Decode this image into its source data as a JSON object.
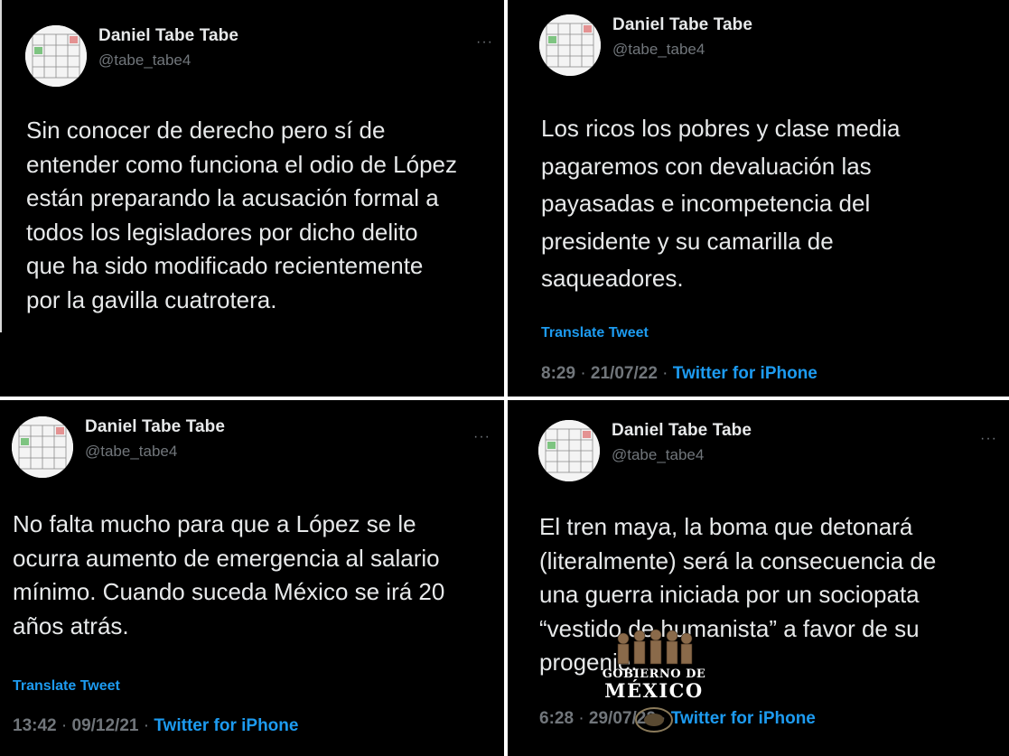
{
  "tweets": [
    {
      "author": {
        "name": "Daniel Tabe Tabe",
        "handle": "@tabe_tabe4",
        "avatar": "avatar-image"
      },
      "text": "Sin conocer de derecho pero sí de\nentender como funciona el odio de López\nestán preparando la acusación formal a\ntodos los legisladores por dicho delito\nque ha sido modificado recientemente\npor la gavilla cuatrotera.",
      "more_icon": "more-horizontal-icon"
    },
    {
      "author": {
        "name": "Daniel Tabe Tabe",
        "handle": "@tabe_tabe4",
        "avatar": "avatar-image"
      },
      "text": "Los ricos los pobres y clase media\npagaremos con devaluación las\npayasadas e incompetencia del\npresidente y su camarilla de\nsaqueadores.",
      "translate_label": "Translate Tweet",
      "time": "8:29",
      "date": "21/07/22",
      "separator": "·",
      "source": "Twitter for iPhone",
      "more_icon": "more-horizontal-icon"
    },
    {
      "author": {
        "name": "Daniel Tabe Tabe",
        "handle": "@tabe_tabe4",
        "avatar": "avatar-image"
      },
      "text": "No falta mucho para que a López se le\nocurra aumento de emergencia al salario\nmínimo. Cuando suceda México se irá 20\naños atrás.",
      "translate_label": "Translate Tweet",
      "time": "13:42",
      "date": "09/12/21",
      "separator": "·",
      "source": "Twitter for iPhone",
      "more_icon": "more-horizontal-icon"
    },
    {
      "author": {
        "name": "Daniel Tabe Tabe",
        "handle": "@tabe_tabe4",
        "avatar": "avatar-image"
      },
      "text": "El tren maya, la boma que detonará\n(literalmente) será la consecuencia de\nuna guerra iniciada por un sociopata\n“vestido de humanista” a favor de su\nprogenie.",
      "time": "6:28",
      "date": "29/07/22",
      "separator": "·",
      "source": "Twitter for iPhone",
      "more_icon": "more-horizontal-icon"
    }
  ],
  "watermark": {
    "line1": "GOBIERNO DE",
    "line2": "MÉXICO"
  },
  "colors": {
    "background": "#000000",
    "text": "#e7e9ea",
    "muted": "#71767b",
    "link": "#1d9bf0"
  }
}
